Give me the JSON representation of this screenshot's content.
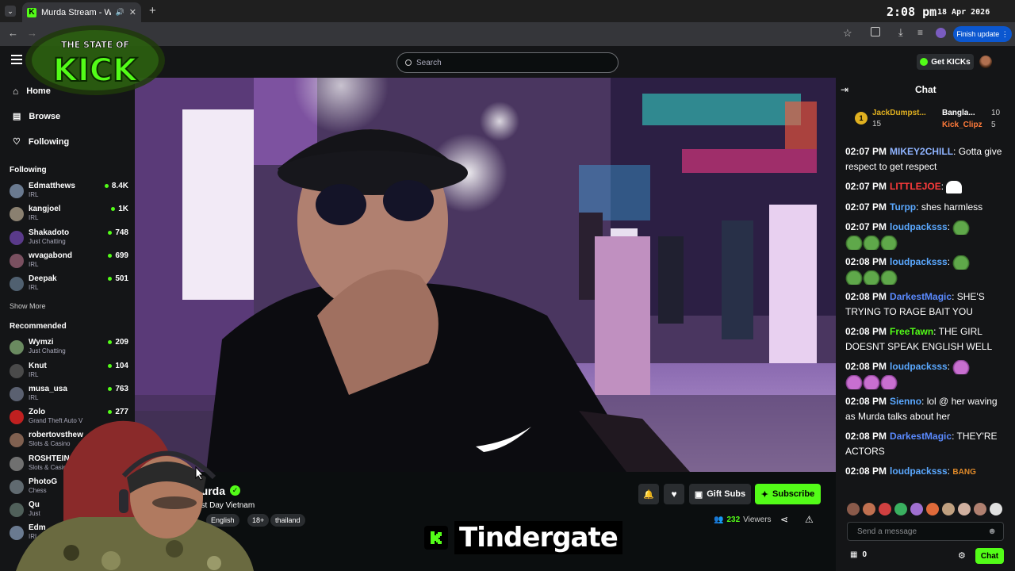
{
  "browser": {
    "tab_title": "Murda Stream - Watch Live",
    "clock": "2:08 pm",
    "date": "18 Apr 2026",
    "finish_update": "Finish update"
  },
  "overlay_logo": {
    "line1": "THE STATE OF",
    "line2": "KICK"
  },
  "header": {
    "search_placeholder": "Search",
    "get_kicks": "Get KICKs"
  },
  "sidebar": {
    "nav": [
      "Home",
      "Browse",
      "Following"
    ],
    "following_title": "Following",
    "following": [
      {
        "name": "Edmatthews",
        "category": "IRL",
        "viewers": "8.4K",
        "color": "#6a7a90"
      },
      {
        "name": "kangjoel",
        "category": "IRL",
        "viewers": "1K",
        "color": "#8a8070"
      },
      {
        "name": "Shakadoto",
        "category": "Just Chatting",
        "viewers": "748",
        "color": "#5a3a8a"
      },
      {
        "name": "wvagabond",
        "category": "IRL",
        "viewers": "699",
        "color": "#7a5060"
      },
      {
        "name": "Deepak",
        "category": "IRL",
        "viewers": "501",
        "color": "#506070"
      }
    ],
    "show_more": "Show More",
    "recommended_title": "Recommended",
    "recommended": [
      {
        "name": "Wymzi",
        "category": "Just Chatting",
        "viewers": "209",
        "color": "#6a8a60"
      },
      {
        "name": "Knut",
        "category": "IRL",
        "viewers": "104",
        "color": "#4a4a4a"
      },
      {
        "name": "musa_usa",
        "category": "IRL",
        "viewers": "763",
        "color": "#5a6070"
      },
      {
        "name": "Zolo",
        "category": "Grand Theft Auto V",
        "viewers": "277",
        "color": "#c02020"
      },
      {
        "name": "robertovsthew",
        "category": "Slots & Casino",
        "viewers": "",
        "color": "#806050"
      },
      {
        "name": "ROSHTEIN",
        "category": "Slots & Casino",
        "viewers": "",
        "color": "#707070"
      },
      {
        "name": "PhotoG",
        "category": "Chess",
        "viewers": "",
        "color": "#606a70"
      },
      {
        "name": "Qu",
        "category": "Just",
        "viewers": "",
        "color": "#50605a"
      },
      {
        "name": "Edm",
        "category": "IRL",
        "viewers": "",
        "color": "#6a7a90"
      }
    ]
  },
  "stream": {
    "streamer": "Murda",
    "title": "ast Day Vietnam",
    "tags": [
      "English",
      "18+",
      "thailand"
    ],
    "viewers": "232",
    "viewers_label": "Viewers",
    "gift_subs": "Gift Subs",
    "subscribe": "Subscribe"
  },
  "chat": {
    "title": "Chat",
    "leaderboard": [
      {
        "rank": "1",
        "name": "JackDumpst...",
        "count": "15"
      },
      {
        "name": "Bangla...",
        "count": "10"
      },
      {
        "name": "Kick_Clipz",
        "count": "5"
      }
    ],
    "messages": [
      {
        "time": "02:07 PM",
        "user": "MIKEY2CHILL",
        "color": "#8fb4ff",
        "text": "Gotta give respect to get respect"
      },
      {
        "time": "02:07 PM",
        "user": "LITTLEJOE",
        "color": "#ff3b3b",
        "text": ""
      },
      {
        "time": "02:07 PM",
        "user": "Turpp",
        "color": "#5aa8ff",
        "text": "shes harmless"
      },
      {
        "time": "02:07 PM",
        "user": "loudpacksss",
        "color": "#5aa8ff",
        "text": ""
      },
      {
        "time": "02:08 PM",
        "user": "loudpacksss",
        "color": "#5aa8ff",
        "text": ""
      },
      {
        "time": "02:08 PM",
        "user": "DarkestMagic",
        "color": "#5a8aff",
        "text": "SHE'S TRYING TO RAGE BAIT YOU"
      },
      {
        "time": "02:08 PM",
        "user": "FreeTawn",
        "color": "#53fc18",
        "text": "THE GIRL DOESNT SPEAK ENGLISH WELL"
      },
      {
        "time": "02:08 PM",
        "user": "loudpacksss",
        "color": "#5aa8ff",
        "text": ""
      },
      {
        "time": "02:08 PM",
        "user": "Sienno",
        "color": "#5aa8ff",
        "text": "lol @ her waving as Murda talks about her"
      },
      {
        "time": "02:08 PM",
        "user": "DarkestMagic",
        "color": "#5a8aff",
        "text": "THEY'RE ACTORS"
      },
      {
        "time": "02:08 PM",
        "user": "loudpacksss",
        "color": "#5aa8ff",
        "text": ""
      }
    ],
    "emote_text": "BANG",
    "input_placeholder": "Send a message",
    "points": "0",
    "send": "Chat"
  },
  "caption": "Tindergate",
  "colors": {
    "kick_green": "#53fc18",
    "bg": "#0b0e0f",
    "panel": "#141517"
  }
}
